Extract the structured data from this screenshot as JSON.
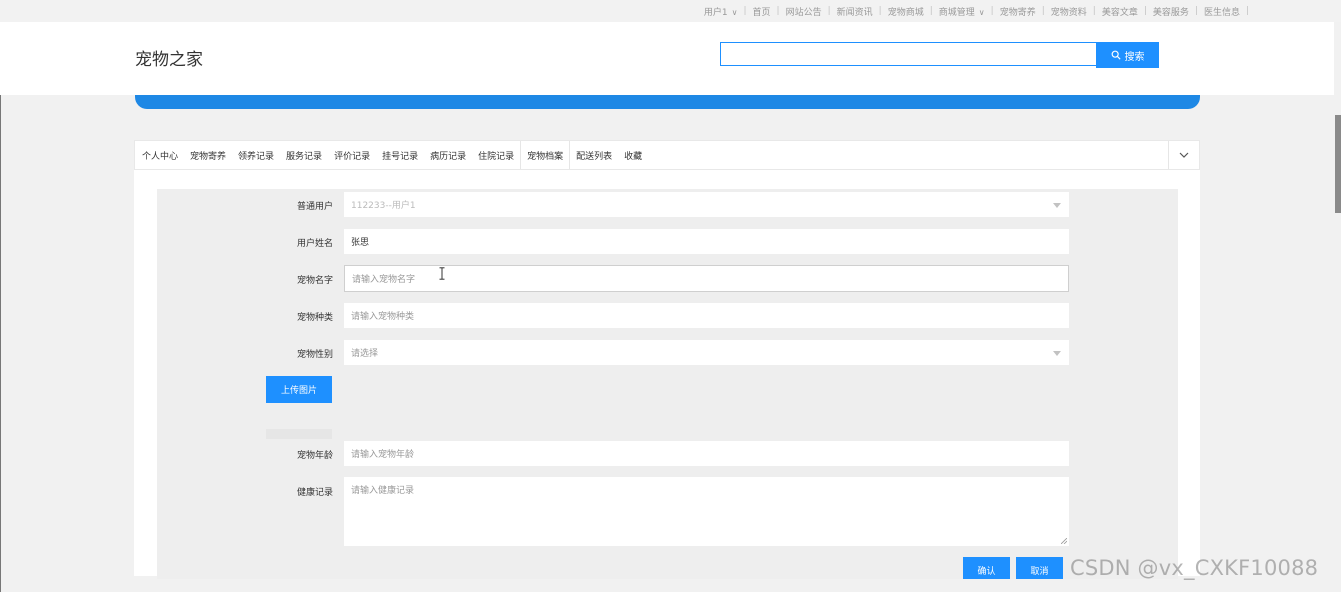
{
  "topnav": {
    "user": "用户1",
    "items": [
      "首页",
      "网站公告",
      "新闻资讯",
      "宠物商城",
      "商城管理",
      "宠物寄养",
      "宠物资料",
      "美容文章",
      "美容服务",
      "医生信息"
    ]
  },
  "header": {
    "site_title": "宠物之家",
    "search_button": "搜索",
    "search_value": ""
  },
  "tabs": {
    "items": [
      "个人中心",
      "宠物寄养",
      "领养记录",
      "服务记录",
      "评价记录",
      "挂号记录",
      "病历记录",
      "住院记录",
      "宠物档案",
      "配送列表",
      "收藏"
    ],
    "active_index": 8
  },
  "form": {
    "user": {
      "label": "普通用户",
      "value": "112233--用户1"
    },
    "name": {
      "label": "用户姓名",
      "value": "张思"
    },
    "pet_name": {
      "label": "宠物名字",
      "placeholder": "请输入宠物名字"
    },
    "pet_type": {
      "label": "宠物种类",
      "placeholder": "请输入宠物种类"
    },
    "pet_gender": {
      "label": "宠物性别",
      "placeholder": "请选择"
    },
    "upload_button": "上传图片",
    "pet_age": {
      "label": "宠物年龄",
      "placeholder": "请输入宠物年龄"
    },
    "health": {
      "label": "健康记录",
      "placeholder": "请输入健康记录"
    },
    "confirm_button": "确认",
    "cancel_button": "取消"
  },
  "watermark": "CSDN @vx_CXKF10088",
  "colors": {
    "primary": "#1e90ff",
    "banner": "#1e88e5"
  }
}
